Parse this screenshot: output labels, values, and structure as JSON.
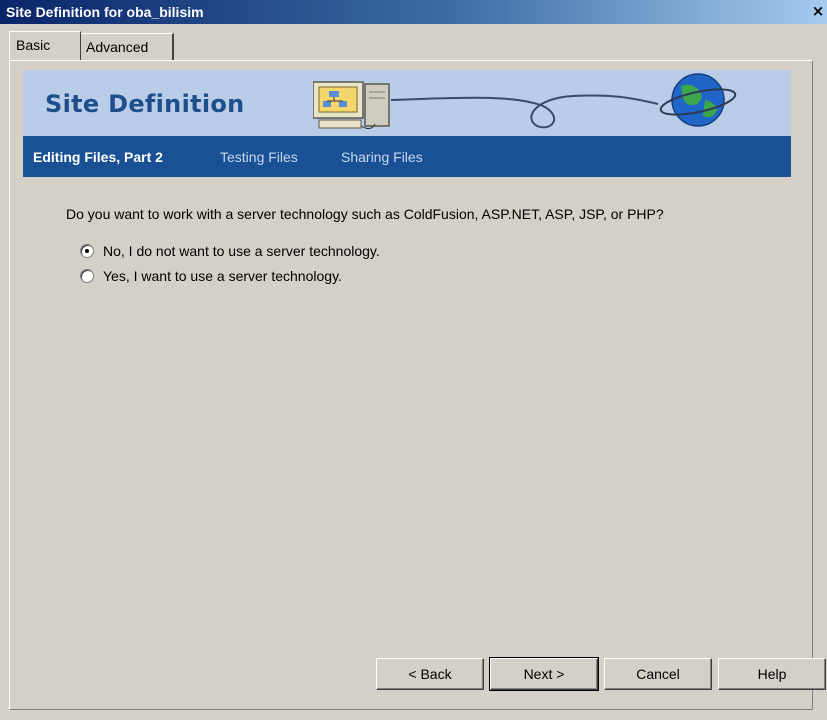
{
  "window": {
    "title": "Site Definition for oba_bilisim",
    "close_label": "×"
  },
  "tabs": [
    {
      "label": "Basic",
      "active": true
    },
    {
      "label": "Advanced",
      "active": false
    }
  ],
  "banner": {
    "title": "Site Definition",
    "icons": [
      "computer-icon",
      "globe-icon"
    ]
  },
  "subnav": [
    {
      "label": "Editing Files, Part 2",
      "active": true
    },
    {
      "label": "Testing Files",
      "active": false
    },
    {
      "label": "Sharing Files",
      "active": false
    }
  ],
  "question": "Do you want to work with a server technology such as ColdFusion, ASP.NET, ASP, JSP, or PHP?",
  "options": [
    {
      "label": "No, I do not want to use a server technology.",
      "checked": true
    },
    {
      "label": "Yes, I want to use a server technology.",
      "checked": false
    }
  ],
  "buttons": {
    "back": "< Back",
    "next": "Next >",
    "cancel": "Cancel",
    "help": "Help"
  },
  "colors": {
    "banner_bg": "#b9cde8",
    "subnav_bg": "#1a5195",
    "title_text": "#1f4e8c"
  }
}
